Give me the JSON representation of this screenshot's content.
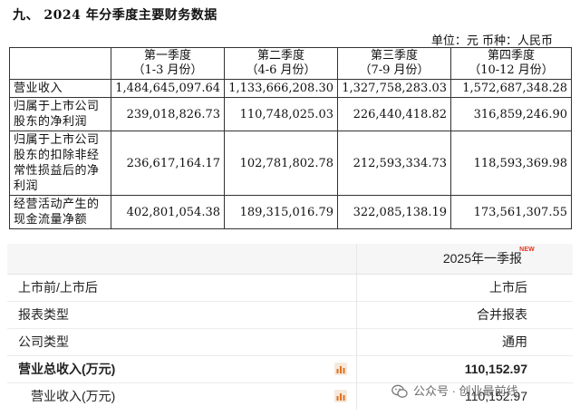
{
  "section_title": "九、 2024 年分季度主要财务数据",
  "unit_line": "单位：元   币种：人民币",
  "table": {
    "headers": [
      {
        "line1": "",
        "line2": ""
      },
      {
        "line1": "第一季度",
        "line2": "（1-3 月份）"
      },
      {
        "line1": "第二季度",
        "line2": "（4-6 月份）"
      },
      {
        "line1": "第三季度",
        "line2": "（7-9 月份）"
      },
      {
        "line1": "第四季度",
        "line2": "（10-12 月份）"
      }
    ],
    "rows": [
      {
        "label": "营业收入",
        "values": [
          "1,484,645,097.64",
          "1,133,666,208.30",
          "1,327,758,283.03",
          "1,572,687,348.28"
        ]
      },
      {
        "label": "归属于上市公司股东的净利润",
        "values": [
          "239,018,826.73",
          "110,748,025.03",
          "226,440,418.82",
          "316,859,246.90"
        ]
      },
      {
        "label": "归属于上市公司股东的扣除非经常性损益后的净利润",
        "values": [
          "236,617,164.17",
          "102,781,802.78",
          "212,593,334.73",
          "118,593,369.98"
        ]
      },
      {
        "label": "经营活动产生的现金流量净额",
        "values": [
          "402,801,054.38",
          "189,315,016.79",
          "322,085,138.19",
          "173,561,307.55"
        ]
      }
    ]
  },
  "report": {
    "period": "2025年一季报",
    "new_badge": "NEW",
    "rows": [
      {
        "label": "上市前/上市后",
        "value": "上市后",
        "bold": false,
        "indent": false,
        "icon": false
      },
      {
        "label": "报表类型",
        "value": "合并报表",
        "bold": false,
        "indent": false,
        "icon": false
      },
      {
        "label": "公司类型",
        "value": "通用",
        "bold": false,
        "indent": false,
        "icon": false
      },
      {
        "label": "营业总收入(万元)",
        "value": "110,152.97",
        "bold": true,
        "indent": false,
        "icon": true
      },
      {
        "label": "营业收入(万元)",
        "value": "110,152.97",
        "bold": false,
        "indent": true,
        "icon": true
      }
    ]
  },
  "watermark": "公众号 · 创业最前线",
  "colors": {
    "badge": "#e8321f",
    "chart_icon": "#e0701f",
    "header_bg": "#f6f6f6"
  }
}
